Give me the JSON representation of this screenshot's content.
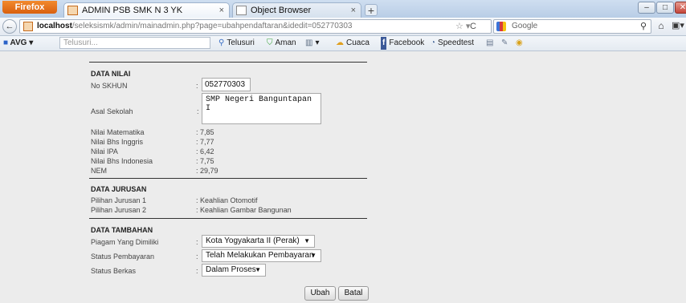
{
  "browser": {
    "menu_button": "Firefox",
    "tabs": [
      {
        "label": "ADMIN PSB SMK N 3 YK",
        "close": "×"
      },
      {
        "label": "Object Browser",
        "close": "×"
      }
    ],
    "new_tab": "+",
    "window_controls": {
      "minimize": "–",
      "maximize": "□",
      "close": "✕"
    }
  },
  "nav": {
    "back": "←",
    "url_host": "localhost",
    "url_path": "/seleksismk/admin/mainadmin.php?page=ubahpendaftaran&idedit=052770303",
    "star": "☆ ▾",
    "reload": "C",
    "search_engine": "Google",
    "search_go": "⚲",
    "home": "⌂",
    "menu": "▣▾"
  },
  "avg_toolbar": {
    "brand": "AVG",
    "brand_caret": "▾",
    "search_placeholder": "Telusuri...",
    "items": [
      {
        "icon": "search-icon",
        "label": "Telusuri"
      },
      {
        "icon": "shield-icon",
        "label": "Aman"
      },
      {
        "icon": "trash-icon",
        "label": "▾"
      },
      {
        "icon": "weather-icon",
        "label": "Cuaca"
      },
      {
        "icon": "facebook-icon",
        "label": "Facebook"
      },
      {
        "icon": "speedtest-icon",
        "label": "Speedtest"
      }
    ]
  },
  "form": {
    "data_nilai": {
      "title": "DATA NILAI",
      "no_skhun": {
        "label": "No SKHUN",
        "colon": ":",
        "value": "052770303"
      },
      "asal_sekolah": {
        "label": "Asal Sekolah",
        "colon": ":",
        "value": "SMP Negeri Banguntapan I"
      },
      "scores": [
        {
          "label": "Nilai Matematika",
          "value": ": 7,85"
        },
        {
          "label": "Nilai Bhs Inggris",
          "value": ": 7,77"
        },
        {
          "label": "Nilai IPA",
          "value": ": 6,42"
        },
        {
          "label": "Nilai Bhs Indonesia",
          "value": ": 7,75"
        },
        {
          "label": "NEM",
          "value": ": 29,79"
        }
      ]
    },
    "data_jurusan": {
      "title": "DATA JURUSAN",
      "rows": [
        {
          "label": "Pilihan Jurusan 1",
          "value": ": Keahlian Otomotif"
        },
        {
          "label": "Pilihan Jurusan 2",
          "value": ": Keahlian Gambar Bangunan"
        }
      ]
    },
    "data_tambahan": {
      "title": "DATA TAMBAHAN",
      "rows": [
        {
          "label": "Piagam Yang Dimiliki",
          "colon": ":",
          "selected": "Kota Yogyakarta II (Perak)"
        },
        {
          "label": "Status Pembayaran",
          "colon": ":",
          "selected": "Telah Melakukan Pembayaran"
        },
        {
          "label": "Status Berkas",
          "colon": ":",
          "selected": "Dalam Proses"
        }
      ]
    },
    "buttons": {
      "ubah": "Ubah",
      "batal": "Batal"
    }
  }
}
